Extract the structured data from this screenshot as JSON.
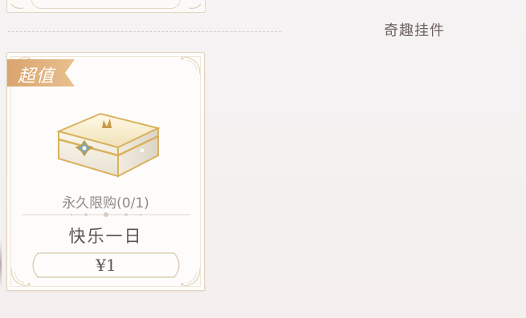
{
  "section": {
    "title": "奇趣挂件"
  },
  "card": {
    "badge": "超值",
    "limit_text": "永久限购(0/1)",
    "item_name": "快乐一日",
    "price": "¥1",
    "item_icon": "treasure-chest-icon"
  },
  "colors": {
    "badge": "#e2b481",
    "card_border": "#e2d3bd",
    "text_dark": "#5a5350",
    "text_muted": "#8f8a88",
    "chest_gold": "#d9b15e"
  }
}
